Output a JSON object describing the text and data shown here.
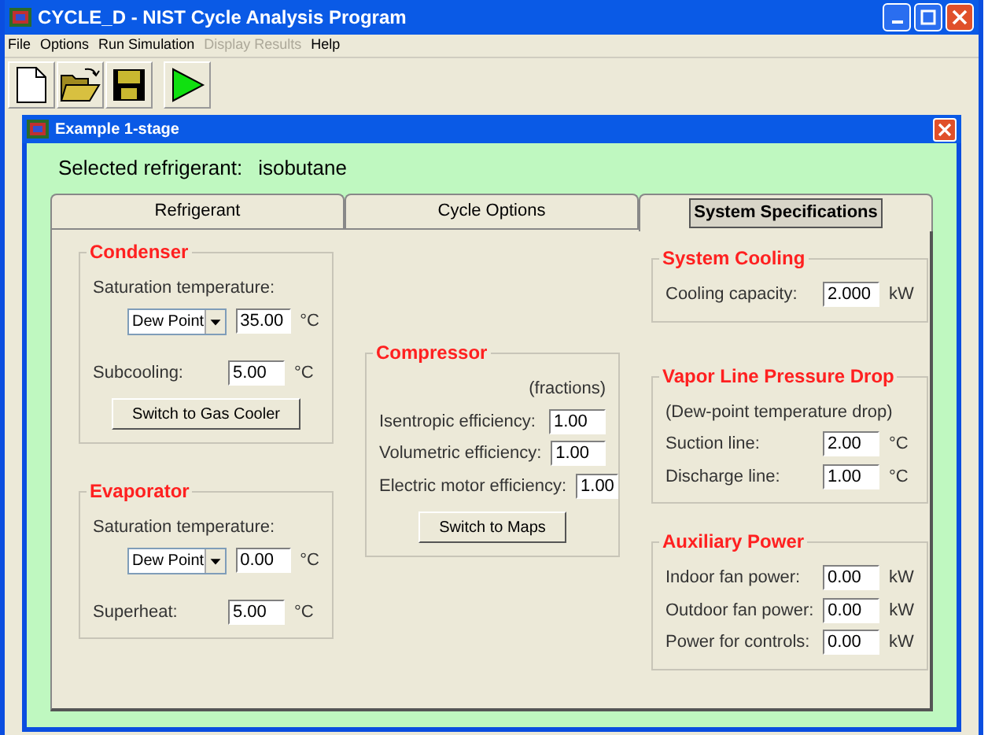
{
  "window": {
    "title": "CYCLE_D - NIST Cycle Analysis Program"
  },
  "menu": [
    {
      "label": "File",
      "disabled": false
    },
    {
      "label": "Options",
      "disabled": false
    },
    {
      "label": "Run Simulation",
      "disabled": false
    },
    {
      "label": "Display Results",
      "disabled": true
    },
    {
      "label": "Help",
      "disabled": false
    }
  ],
  "toolbar": [
    {
      "kind": "new"
    },
    {
      "kind": "open"
    },
    {
      "kind": "save"
    },
    {
      "kind": "run"
    }
  ],
  "document": {
    "title": "Example 1-stage",
    "refrigerant_label": "Selected refrigerant:",
    "refrigerant": "isobutane"
  },
  "tabs": [
    {
      "label": "Refrigerant",
      "selected": false
    },
    {
      "label": "Cycle Options",
      "selected": false
    },
    {
      "label": "System Specifications",
      "selected": true
    }
  ],
  "columns": [
    [
      {
        "title": "Condenser",
        "rows": [
          {
            "kind": "caption",
            "text": "Saturation temperature:"
          },
          {
            "kind": "select_input",
            "option": "Dew Point",
            "value": "35.00",
            "unit": "°C"
          },
          {
            "kind": "field",
            "label": "Subcooling:",
            "value": "5.00",
            "unit": "°C"
          },
          {
            "kind": "button",
            "label": "Switch to Gas Cooler"
          }
        ]
      },
      {
        "title": "Evaporator",
        "rows": [
          {
            "kind": "caption",
            "text": "Saturation temperature:"
          },
          {
            "kind": "select_input",
            "option": "Dew Point",
            "value": "0.00",
            "unit": "°C"
          },
          {
            "kind": "field",
            "label": "Superheat:",
            "value": "5.00",
            "unit": "°C"
          }
        ]
      }
    ],
    [
      {
        "title": "Compressor",
        "rows": [
          {
            "kind": "note",
            "text": "(fractions)"
          },
          {
            "kind": "field",
            "label": "Isentropic efficiency:",
            "value": "1.00"
          },
          {
            "kind": "field",
            "label": "Volumetric efficiency:",
            "value": "1.00"
          },
          {
            "kind": "field",
            "label": "Electric motor efficiency:",
            "value": "1.00"
          },
          {
            "kind": "button",
            "label": "Switch to Maps"
          }
        ]
      }
    ],
    [
      {
        "title": "System Cooling",
        "rows": [
          {
            "kind": "field",
            "label": "Cooling capacity:",
            "value": "2.000",
            "unit": "kW"
          }
        ]
      },
      {
        "title": "Vapor Line Pressure Drop",
        "rows": [
          {
            "kind": "caption",
            "text": "(Dew-point temperature drop)"
          },
          {
            "kind": "field",
            "label": "Suction line:",
            "value": "2.00",
            "unit": "°C"
          },
          {
            "kind": "field",
            "label": "Discharge line:",
            "value": "1.00",
            "unit": "°C"
          }
        ]
      },
      {
        "title": "Auxiliary Power",
        "rows": [
          {
            "kind": "field",
            "label": "Indoor fan power:",
            "value": "0.00",
            "unit": "kW"
          },
          {
            "kind": "field",
            "label": "Outdoor fan power:",
            "value": "0.00",
            "unit": "kW"
          },
          {
            "kind": "field",
            "label": "Power for controls:",
            "value": "0.00",
            "unit": "kW"
          }
        ]
      }
    ]
  ]
}
